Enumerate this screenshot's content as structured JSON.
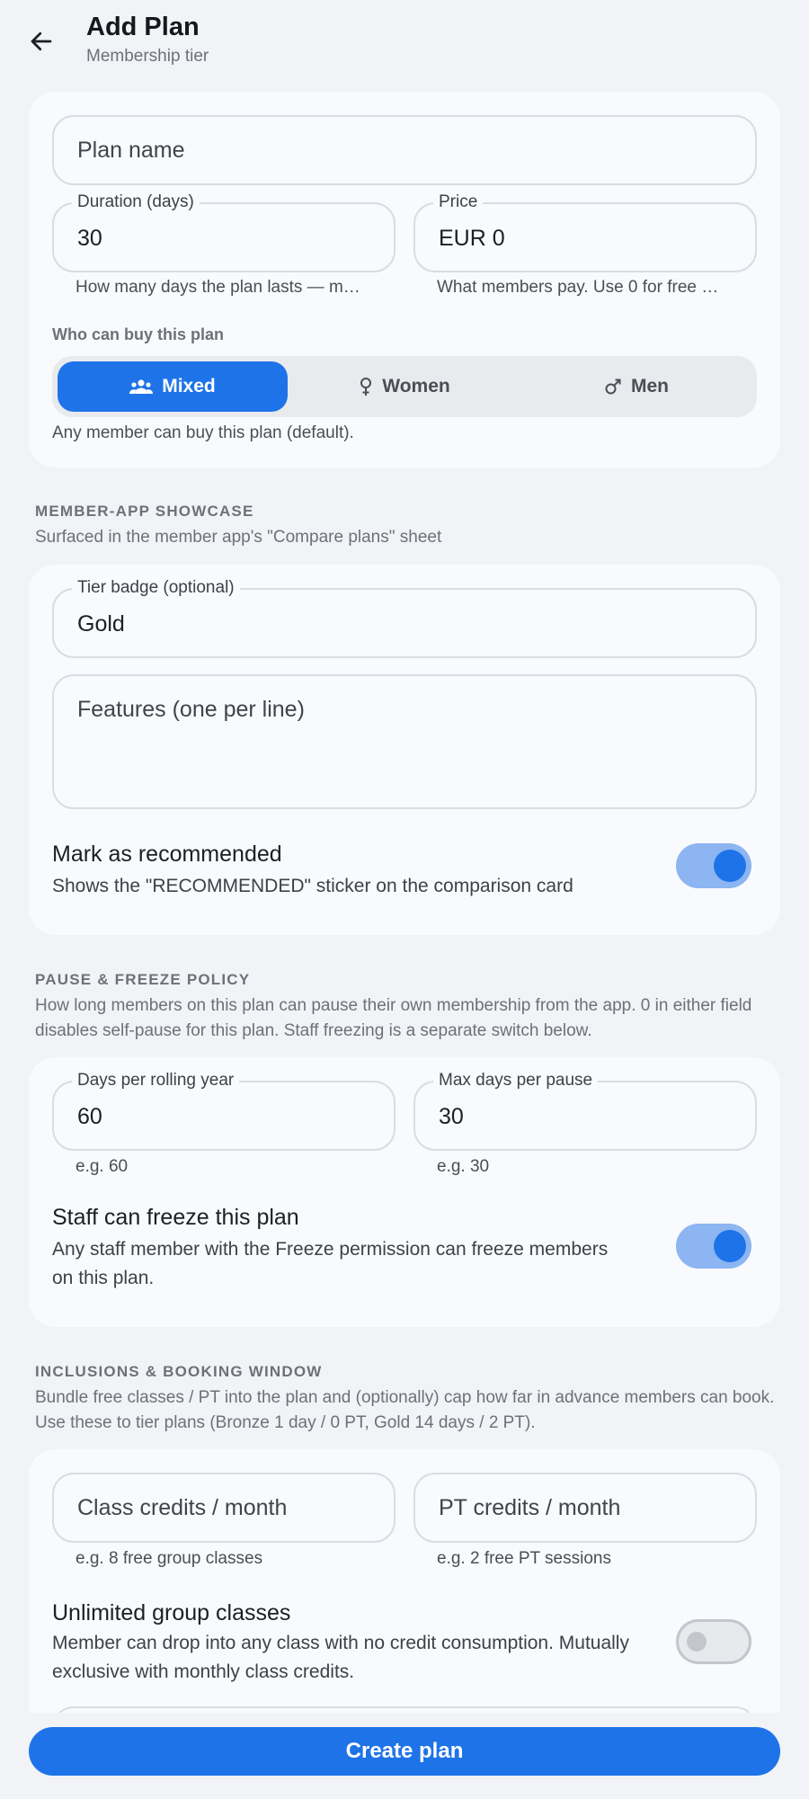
{
  "header": {
    "title": "Add Plan",
    "subtitle": "Membership tier"
  },
  "plan": {
    "name_placeholder": "Plan name",
    "duration": {
      "label": "Duration (days)",
      "value": "30",
      "helper": "How many days the plan lasts — m…"
    },
    "price": {
      "label": "Price",
      "value": "EUR 0",
      "helper": "What members pay. Use 0 for free …"
    },
    "buyer_label": "Who can buy this plan",
    "buyer_options": [
      {
        "label": "Mixed",
        "icon": "group-icon",
        "selected": true
      },
      {
        "label": "Women",
        "icon": "female-icon",
        "selected": false
      },
      {
        "label": "Men",
        "icon": "male-icon",
        "selected": false
      }
    ],
    "buyer_helper": "Any member can buy this plan (default)."
  },
  "showcase": {
    "title": "MEMBER-APP SHOWCASE",
    "desc": "Surfaced in the member app's \"Compare plans\" sheet",
    "tier_badge": {
      "label": "Tier badge (optional)",
      "value": "Gold"
    },
    "features_placeholder": "Features (one per line)",
    "recommended": {
      "title": "Mark as recommended",
      "subtitle": "Shows the \"RECOMMENDED\" sticker on the comparison card",
      "on": true
    }
  },
  "pause": {
    "title": "PAUSE & FREEZE POLICY",
    "desc": "How long members on this plan can pause their own membership from the app. 0 in either field disables self-pause for this plan. Staff freezing is a separate switch below.",
    "days_per_year": {
      "label": "Days per rolling year",
      "value": "60",
      "helper": "e.g. 60"
    },
    "max_per_pause": {
      "label": "Max days per pause",
      "value": "30",
      "helper": "e.g. 30"
    },
    "staff_freeze": {
      "title": "Staff can freeze this plan",
      "subtitle": "Any staff member with the Freeze permission can freeze members on this plan.",
      "on": true
    }
  },
  "inclusions": {
    "title": "INCLUSIONS & BOOKING WINDOW",
    "desc": "Bundle free classes / PT into the plan and (optionally) cap how far in advance members can book. Use these to tier plans (Bronze 1 day / 0 PT, Gold 14 days / 2 PT).",
    "class_credits": {
      "placeholder": "Class credits / month",
      "helper": "e.g. 8 free group classes"
    },
    "pt_credits": {
      "placeholder": "PT credits / month",
      "helper": "e.g. 2 free PT sessions"
    },
    "unlimited": {
      "title": "Unlimited group classes",
      "subtitle": "Member can drop into any class with no credit consumption. Mutually exclusive with monthly class credits.",
      "on": false
    }
  },
  "footer": {
    "cta": "Create plan"
  },
  "colors": {
    "accent": "#1e73e8",
    "background": "#f1f3f7",
    "card": "#f9fafd"
  }
}
